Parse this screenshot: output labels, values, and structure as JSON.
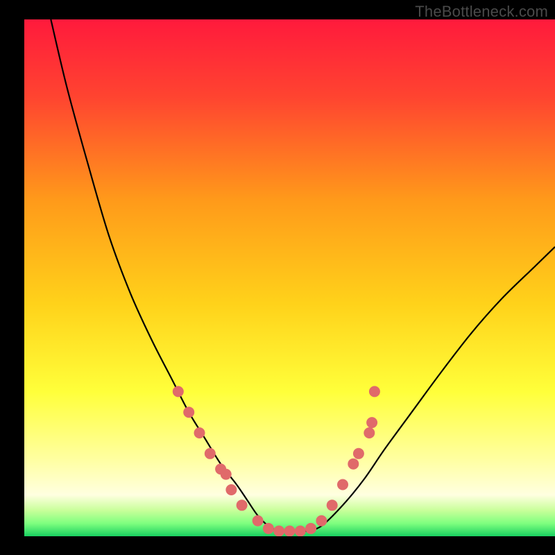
{
  "watermark": "TheBottleneck.com",
  "chart_data": {
    "type": "line",
    "title": "",
    "xlabel": "",
    "ylabel": "",
    "xlim": [
      0,
      100
    ],
    "ylim": [
      0,
      100
    ],
    "background_gradient": {
      "stops": [
        {
          "offset": 0.0,
          "color": "#ff1a3c"
        },
        {
          "offset": 0.15,
          "color": "#ff4430"
        },
        {
          "offset": 0.35,
          "color": "#ff9a1a"
        },
        {
          "offset": 0.55,
          "color": "#ffd21a"
        },
        {
          "offset": 0.72,
          "color": "#ffff3a"
        },
        {
          "offset": 0.85,
          "color": "#ffffa0"
        },
        {
          "offset": 0.92,
          "color": "#ffffe0"
        },
        {
          "offset": 0.95,
          "color": "#c8ff9a"
        },
        {
          "offset": 0.975,
          "color": "#7fff7f"
        },
        {
          "offset": 1.0,
          "color": "#18d060"
        }
      ]
    },
    "series": [
      {
        "name": "bottleneck-curve",
        "color": "#000000",
        "x": [
          5,
          8,
          12,
          16,
          20,
          24,
          28,
          31,
          34,
          37,
          40,
          42,
          44,
          46,
          48,
          50,
          53,
          56,
          60,
          64,
          68,
          73,
          78,
          84,
          90,
          96,
          100
        ],
        "y": [
          100,
          87,
          72,
          58,
          47,
          38,
          30,
          24,
          19,
          14,
          10,
          7,
          4,
          2,
          1,
          1,
          1,
          2,
          6,
          11,
          17,
          24,
          31,
          39,
          46,
          52,
          56
        ]
      }
    ],
    "markers": {
      "name": "highlight-points",
      "color": "#e06a6a",
      "radius": 8,
      "points": [
        {
          "x": 29,
          "y": 28
        },
        {
          "x": 31,
          "y": 24
        },
        {
          "x": 33,
          "y": 20
        },
        {
          "x": 35,
          "y": 16
        },
        {
          "x": 37,
          "y": 13
        },
        {
          "x": 38,
          "y": 12
        },
        {
          "x": 39,
          "y": 9
        },
        {
          "x": 41,
          "y": 6
        },
        {
          "x": 44,
          "y": 3
        },
        {
          "x": 46,
          "y": 1.5
        },
        {
          "x": 48,
          "y": 1
        },
        {
          "x": 50,
          "y": 1
        },
        {
          "x": 52,
          "y": 1
        },
        {
          "x": 54,
          "y": 1.5
        },
        {
          "x": 56,
          "y": 3
        },
        {
          "x": 58,
          "y": 6
        },
        {
          "x": 60,
          "y": 10
        },
        {
          "x": 62,
          "y": 14
        },
        {
          "x": 63,
          "y": 16
        },
        {
          "x": 65,
          "y": 20
        },
        {
          "x": 65.5,
          "y": 22
        },
        {
          "x": 66,
          "y": 28
        }
      ]
    }
  }
}
